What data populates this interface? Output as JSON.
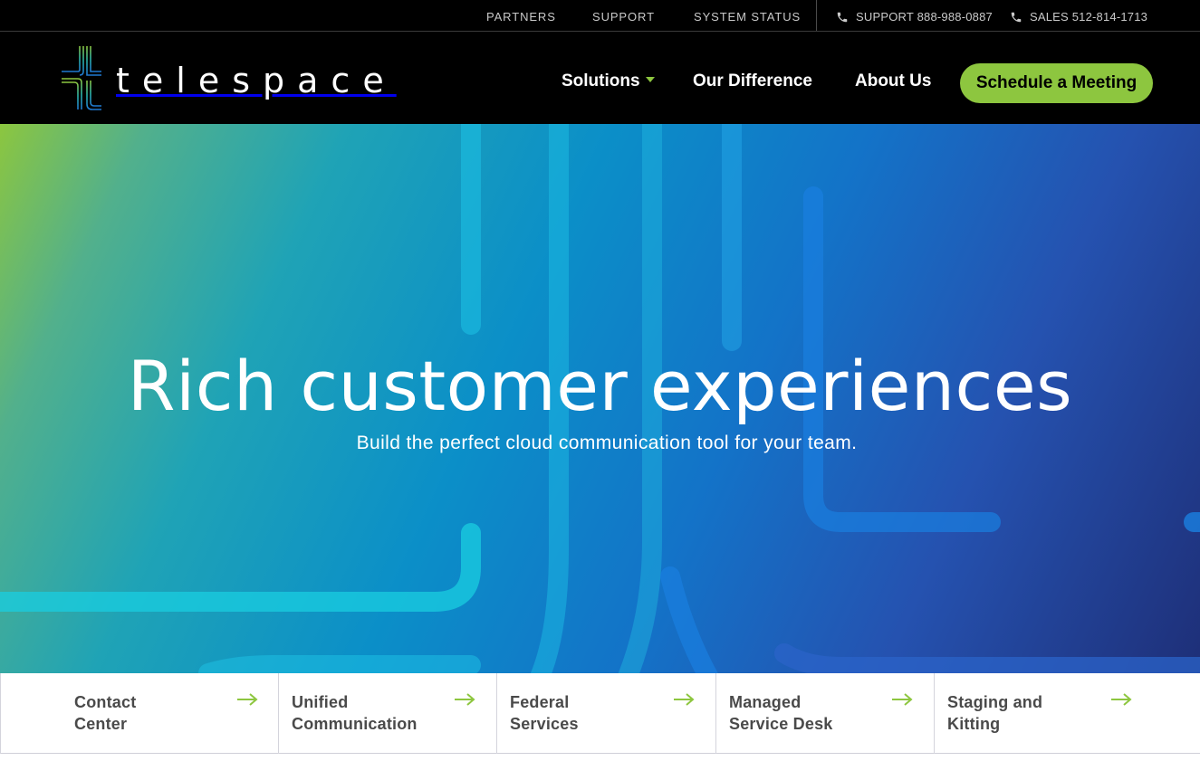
{
  "topbar": {
    "links": [
      "PARTNERS",
      "SUPPORT",
      "SYSTEM STATUS"
    ],
    "support_phone": "SUPPORT 888-988-0887",
    "sales_phone": "SALES 512-814-1713"
  },
  "nav": {
    "logo_text": "telespace",
    "items": [
      "Solutions",
      "Our Difference",
      "About Us"
    ],
    "cta": "Schedule a Meeting"
  },
  "hero": {
    "title": "Rich customer experiences",
    "subtitle": "Build the perfect cloud communication tool for your team."
  },
  "cards": [
    {
      "line1": "Contact",
      "line2": "Center"
    },
    {
      "line1": "Unified",
      "line2": "Communication"
    },
    {
      "line1": "Federal",
      "line2": "Services"
    },
    {
      "line1": "Managed",
      "line2": "Service Desk"
    },
    {
      "line1": "Staging and",
      "line2": "Kitting"
    }
  ],
  "colors": {
    "accent": "#8dc63f",
    "nav_bg": "#000000",
    "card_text": "#4a4a4a"
  },
  "icons": [
    "phone-icon",
    "logo-mark-icon",
    "chevron-down-icon",
    "arrow-right-icon"
  ]
}
